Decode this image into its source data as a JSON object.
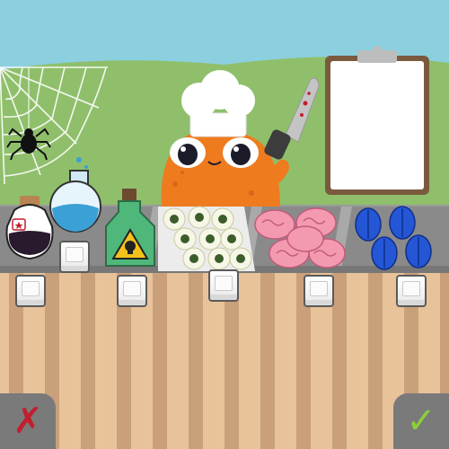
{
  "scene": {
    "colors": {
      "sky": "#8ccfdf",
      "hill": "#8fbf6b",
      "counter": "#8a8a8a",
      "counter_top": "#a9a9a9",
      "floor_light": "#e8c39a",
      "floor_dark": "#c9a07a",
      "chef_body": "#ef7b1f",
      "eyeball_tray": "#ececec",
      "brain": "#f49ab0",
      "beetle": "#2456d6",
      "potion_purple": "#2a1a2e",
      "potion_blue": "#3aa0d6",
      "potion_green": "#4fb77a",
      "clipboard_frame": "#7a5a3e",
      "reject_mark": "#c21e2e",
      "confirm_mark": "#8ccf3a"
    }
  },
  "ingredients": [
    {
      "name": "heart-potion"
    },
    {
      "name": "blue-flask"
    },
    {
      "name": "poison-bottle"
    },
    {
      "name": "eyeballs"
    },
    {
      "name": "brains"
    },
    {
      "name": "beetles"
    }
  ],
  "controls": {
    "reject_glyph": "✗",
    "confirm_glyph": "✓"
  }
}
